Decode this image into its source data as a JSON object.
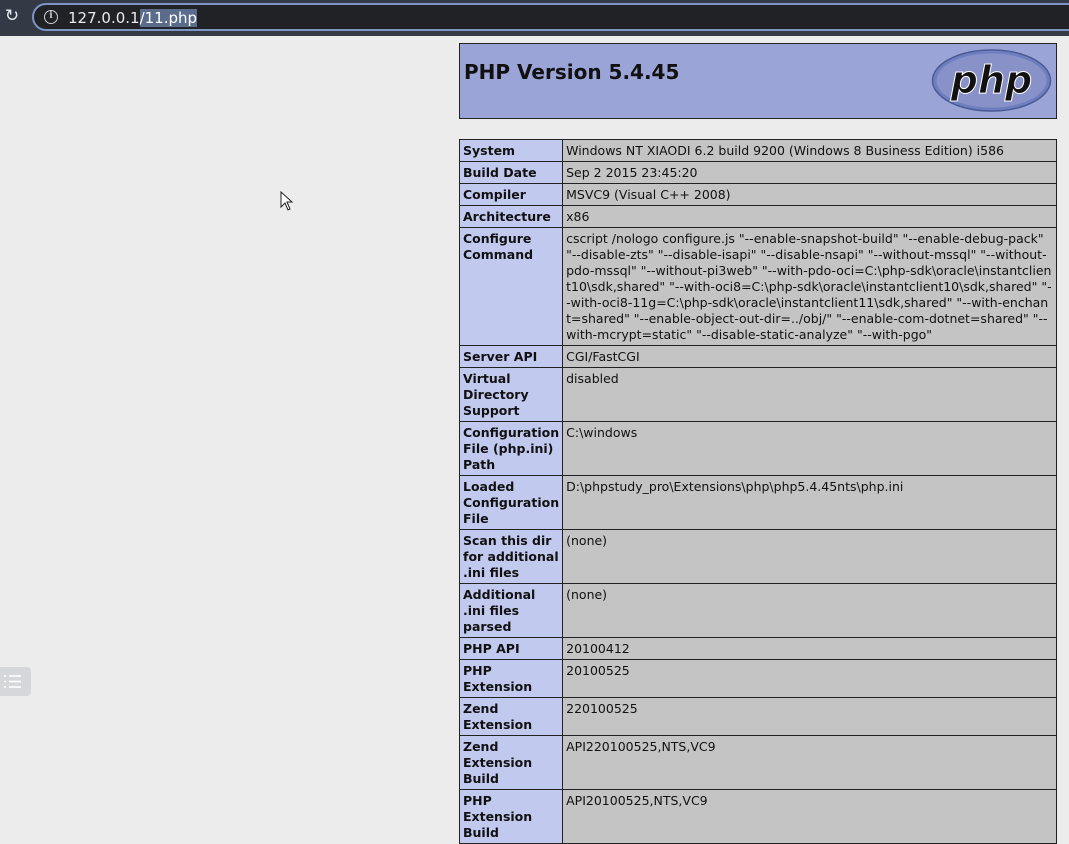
{
  "browser": {
    "url_host": "127.0.0.1",
    "url_path": "/11.php"
  },
  "header": {
    "title": "PHP Version 5.4.45",
    "logo_text": "php"
  },
  "rows": [
    {
      "label": "System",
      "value": "Windows NT XIAODI 6.2 build 9200 (Windows 8 Business Edition) i586"
    },
    {
      "label": "Build Date",
      "value": "Sep 2 2015 23:45:20"
    },
    {
      "label": "Compiler",
      "value": "MSVC9 (Visual C++ 2008)"
    },
    {
      "label": "Architecture",
      "value": "x86"
    },
    {
      "label": "Configure Command",
      "value": "cscript /nologo configure.js \"--enable-snapshot-build\" \"--enable-debug-pack\" \"--disable-zts\" \"--disable-isapi\" \"--disable-nsapi\" \"--without-mssql\" \"--without-pdo-mssql\" \"--without-pi3web\" \"--with-pdo-oci=C:\\php-sdk\\oracle\\instantclient10\\sdk,shared\" \"--with-oci8=C:\\php-sdk\\oracle\\instantclient10\\sdk,shared\" \"--with-oci8-11g=C:\\php-sdk\\oracle\\instantclient11\\sdk,shared\" \"--with-enchant=shared\" \"--enable-object-out-dir=../obj/\" \"--enable-com-dotnet=shared\" \"--with-mcrypt=static\" \"--disable-static-analyze\" \"--with-pgo\""
    },
    {
      "label": "Server API",
      "value": "CGI/FastCGI"
    },
    {
      "label": "Virtual Directory Support",
      "value": "disabled"
    },
    {
      "label": "Configuration File (php.ini) Path",
      "value": "C:\\windows"
    },
    {
      "label": "Loaded Configuration File",
      "value": "D:\\phpstudy_pro\\Extensions\\php\\php5.4.45nts\\php.ini"
    },
    {
      "label": "Scan this dir for additional .ini files",
      "value": "(none)"
    },
    {
      "label": "Additional .ini files parsed",
      "value": "(none)"
    },
    {
      "label": "PHP API",
      "value": "20100412"
    },
    {
      "label": "PHP Extension",
      "value": "20100525"
    },
    {
      "label": "Zend Extension",
      "value": "220100525"
    },
    {
      "label": "Zend Extension Build",
      "value": "API220100525,NTS,VC9"
    },
    {
      "label": "PHP Extension Build",
      "value": "API20100525,NTS,VC9"
    }
  ]
}
